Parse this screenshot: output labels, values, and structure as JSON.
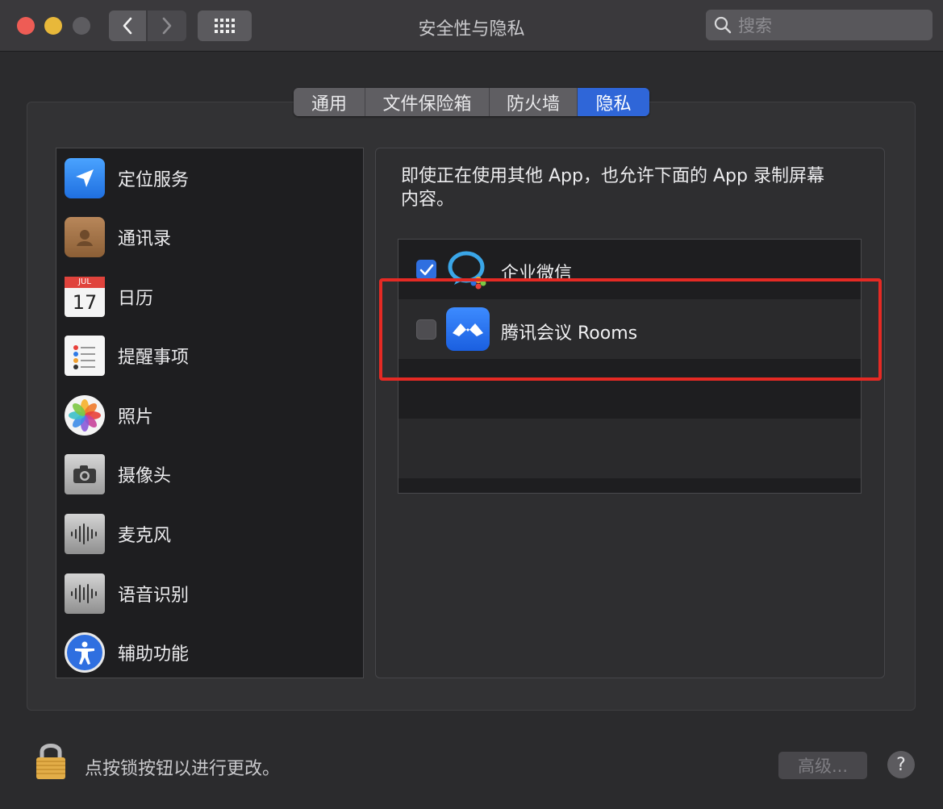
{
  "window": {
    "title": "安全性与隐私"
  },
  "search": {
    "placeholder": "搜索"
  },
  "tabs": [
    {
      "label": "通用",
      "active": false
    },
    {
      "label": "文件保险箱",
      "active": false
    },
    {
      "label": "防火墙",
      "active": false
    },
    {
      "label": "隐私",
      "active": true
    }
  ],
  "sidebar": {
    "items": [
      {
        "label": "定位服务",
        "icon": "location-arrow-icon"
      },
      {
        "label": "通讯录",
        "icon": "contacts-book-icon"
      },
      {
        "label": "日历",
        "icon": "calendar-icon",
        "month": "JUL",
        "day": "17"
      },
      {
        "label": "提醒事项",
        "icon": "reminders-icon"
      },
      {
        "label": "照片",
        "icon": "photos-flower-icon"
      },
      {
        "label": "摄像头",
        "icon": "camera-icon"
      },
      {
        "label": "麦克风",
        "icon": "microphone-waveform-icon"
      },
      {
        "label": "语音识别",
        "icon": "speech-waveform-icon"
      },
      {
        "label": "辅助功能",
        "icon": "accessibility-icon"
      }
    ]
  },
  "panel": {
    "description_line1": "即使正在使用其他 App，也允许下面的 App 录制屏幕",
    "description_line2": "内容。",
    "apps": [
      {
        "name": "企业微信",
        "checked": true,
        "icon": "wecom-icon"
      },
      {
        "name": "腾讯会议 Rooms",
        "checked": false,
        "icon": "tencent-meeting-icon"
      }
    ]
  },
  "footer": {
    "lock_text": "点按锁按钮以进行更改。",
    "advanced_label": "高级...",
    "help_label": "?"
  },
  "colors": {
    "accent": "#2f66d8",
    "highlight": "#e52a24",
    "background": "#2b2b2d"
  }
}
